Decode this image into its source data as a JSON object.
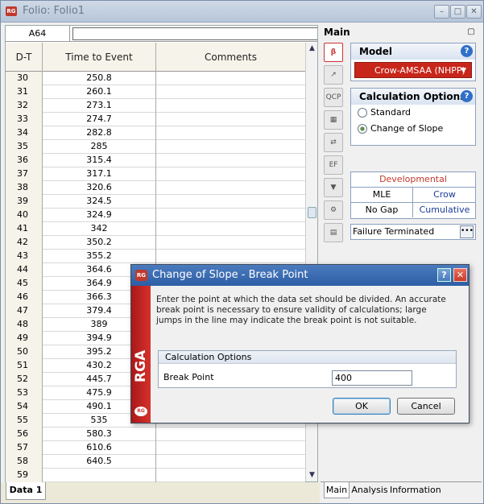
{
  "window": {
    "title": "Folio: Folio1",
    "app_icon_text": "RG"
  },
  "grid": {
    "cell_ref": "A64",
    "formula_value": "",
    "headers": {
      "dt": "D-T",
      "tte": "Time to Event",
      "comments": "Comments"
    },
    "rows": [
      {
        "dt": "30",
        "tte": "250.8"
      },
      {
        "dt": "31",
        "tte": "260.1"
      },
      {
        "dt": "32",
        "tte": "273.1"
      },
      {
        "dt": "33",
        "tte": "274.7"
      },
      {
        "dt": "34",
        "tte": "282.8"
      },
      {
        "dt": "35",
        "tte": "285"
      },
      {
        "dt": "36",
        "tte": "315.4"
      },
      {
        "dt": "37",
        "tte": "317.1"
      },
      {
        "dt": "38",
        "tte": "320.6"
      },
      {
        "dt": "39",
        "tte": "324.5"
      },
      {
        "dt": "40",
        "tte": "324.9"
      },
      {
        "dt": "41",
        "tte": "342"
      },
      {
        "dt": "42",
        "tte": "350.2"
      },
      {
        "dt": "43",
        "tte": "355.2"
      },
      {
        "dt": "44",
        "tte": "364.6"
      },
      {
        "dt": "45",
        "tte": "364.9"
      },
      {
        "dt": "46",
        "tte": "366.3"
      },
      {
        "dt": "47",
        "tte": "379.4"
      },
      {
        "dt": "48",
        "tte": "389"
      },
      {
        "dt": "49",
        "tte": "394.9"
      },
      {
        "dt": "50",
        "tte": "395.2"
      },
      {
        "dt": "51",
        "tte": "430.2"
      },
      {
        "dt": "52",
        "tte": "445.7"
      },
      {
        "dt": "53",
        "tte": "475.9"
      },
      {
        "dt": "54",
        "tte": "490.1"
      },
      {
        "dt": "55",
        "tte": "535"
      },
      {
        "dt": "56",
        "tte": "580.3"
      },
      {
        "dt": "57",
        "tte": "610.6"
      },
      {
        "dt": "58",
        "tte": "640.5"
      },
      {
        "dt": "59",
        "tte": ""
      }
    ],
    "sheet_tab": "Data 1"
  },
  "panel": {
    "title": "Main",
    "model": {
      "header": "Model",
      "selected": "Crow-AMSAA (NHPP)"
    },
    "calc_options": {
      "header": "Calculation Options",
      "standard": "Standard",
      "change_of_slope": "Change of Slope",
      "selected": "Change of Slope"
    },
    "dev_table": {
      "header": "Developmental",
      "rows": [
        {
          "left": "MLE",
          "right": "Crow"
        },
        {
          "left": "No Gap",
          "right": "Cumulative"
        }
      ]
    },
    "termination": "Failure Terminated",
    "termination_button": "•••",
    "tabs": {
      "main": "Main",
      "analysis": "Analysis",
      "information": "Information"
    }
  },
  "dialog": {
    "title": "Change of Slope - Break Point",
    "message": "Enter the point at which the data set should be divided. An accurate break point is necessary to ensure validity of calculations; large jumps in the line may indicate the break point is not suitable.",
    "side_text": "RGA",
    "box_header": "Calculation Options",
    "break_point_label": "Break Point",
    "break_point_value": "400",
    "ok": "OK",
    "cancel": "Cancel"
  },
  "colors": {
    "accent_red": "#c8261a",
    "link_blue": "#1a3a9a",
    "title_blue": "#2d5ea6"
  }
}
